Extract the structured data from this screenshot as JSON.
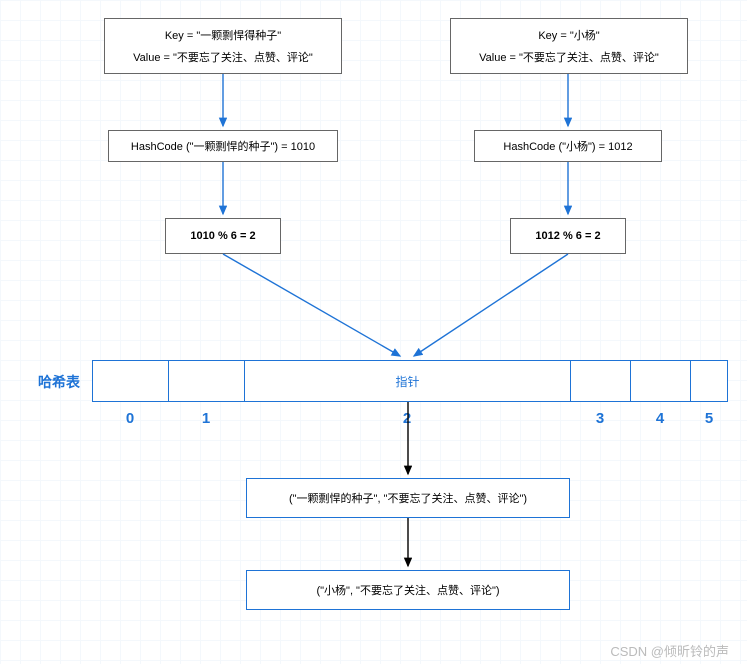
{
  "left": {
    "kv_key_label": "Key = ",
    "kv_key_value": "\"一颗剽悍得种子\"",
    "kv_val_label": "Value = ",
    "kv_val_value": "\"不要忘了关注、点赞、评论\"",
    "hashcode_text": "HashCode (\"一颗剽悍的种子\") = 1010",
    "mod_text": "1010 % 6 = 2"
  },
  "right": {
    "kv_key_label": "Key = ",
    "kv_key_value": "\"小杨\"",
    "kv_val_label": "Value = ",
    "kv_val_value": "\"不要忘了关注、点赞、评论\"",
    "hashcode_text": "HashCode (\"小杨\") = 1012",
    "mod_text": "1012 % 6 = 2"
  },
  "hashtable": {
    "label": "哈希表",
    "pointer_label": "指针",
    "indices": [
      "0",
      "1",
      "2",
      "3",
      "4",
      "5"
    ]
  },
  "entries": {
    "first": "(\"一颗剽悍的种子\", \"不要忘了关注、点赞、评论\")",
    "second": "(\"小杨\", \"不要忘了关注、点赞、评论\")"
  },
  "watermark": "CSDN @倾昕铃的声"
}
